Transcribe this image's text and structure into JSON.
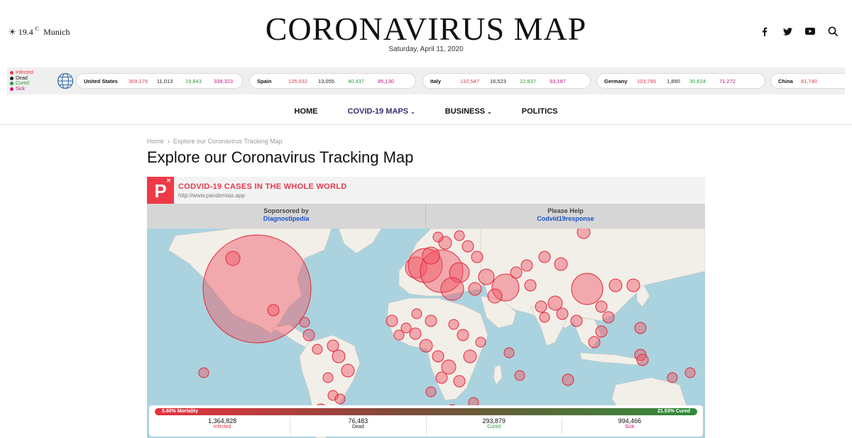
{
  "header": {
    "weather": {
      "icon": "sun-icon",
      "temp": "19.4",
      "unit": "C",
      "city": "Munich"
    },
    "title": "CORONAVIRUS MAP",
    "date": "Saturday, April 11, 2020",
    "socials": [
      {
        "name": "facebook-icon",
        "glyph": "f"
      },
      {
        "name": "twitter-icon",
        "glyph": "t"
      },
      {
        "name": "youtube-icon",
        "glyph": "▶"
      },
      {
        "name": "search-icon",
        "glyph": "⚲"
      }
    ]
  },
  "ticker": {
    "legend": [
      "Infected",
      "Dead",
      "Cured",
      "Sick"
    ],
    "colors": {
      "infected": "#e23a4a",
      "dead": "#222222",
      "cured": "#2a9d3a",
      "sick": "#c0197a"
    },
    "countries": [
      {
        "name": "United States",
        "infected": "369,179",
        "dead": "11,013",
        "cured": "19,843",
        "sick": "338,323"
      },
      {
        "name": "Spain",
        "infected": "135,032",
        "dead": "13,055",
        "cured": "40,437",
        "sick": "85,130"
      },
      {
        "name": "Italy",
        "infected": "132,547",
        "dead": "16,523",
        "cured": "22,837",
        "sick": "93,187"
      },
      {
        "name": "Germany",
        "infected": "103,786",
        "dead": "1,890",
        "cured": "30,624",
        "sick": "71,272"
      },
      {
        "name": "China",
        "infected": "81,740",
        "dead": "",
        "cured": "",
        "sick": ""
      }
    ]
  },
  "nav": {
    "items": [
      {
        "label": "HOME",
        "dropdown": false,
        "active": false
      },
      {
        "label": "COVID-19 MAPS",
        "dropdown": true,
        "active": true
      },
      {
        "label": "BUSINESS",
        "dropdown": true,
        "active": false
      },
      {
        "label": "POLITICS",
        "dropdown": false,
        "active": false
      }
    ]
  },
  "breadcrumb": {
    "home": "Home",
    "separator": "›",
    "current": "Explore our Coronavirus Tracking Map"
  },
  "page": {
    "title": "Explore our Coronavirus Tracking Map"
  },
  "widget": {
    "logo_letter": "P",
    "title": "CODVID-19 CASES IN THE WHOLE WORLD",
    "url": "http://www.pandemias.app",
    "sponsor": {
      "label": "Soporsored by",
      "link": "Diagnostipedia"
    },
    "help": {
      "label": "Please Help",
      "link": "Codvid19response"
    },
    "mortality": "5.60% Mortality",
    "cured_pct": "21.53% Cured",
    "totals": [
      {
        "value": "1,364,828",
        "label": "Infected"
      },
      {
        "value": "76,483",
        "label": "Dead"
      },
      {
        "value": "293,879",
        "label": "Cured"
      },
      {
        "value": "994,466",
        "label": "Sick"
      }
    ],
    "accent": "#ee3a48",
    "ocean_color": "#aad3df",
    "land_color": "#f2efe9"
  }
}
